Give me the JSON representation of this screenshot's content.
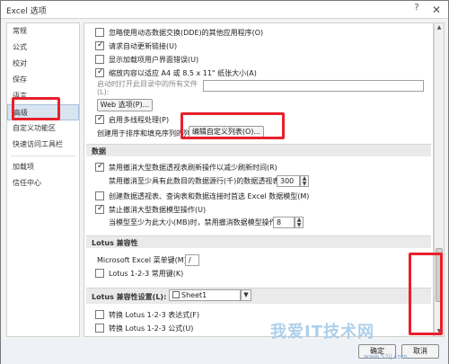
{
  "window": {
    "title": "Excel 选项",
    "help": "?",
    "close": "✕"
  },
  "sidebar": {
    "items": [
      {
        "label": "常规"
      },
      {
        "label": "公式"
      },
      {
        "label": "校对"
      },
      {
        "label": "保存"
      },
      {
        "label": "语言"
      },
      {
        "label": "高级",
        "selected": true
      },
      {
        "label": "自定义功能区"
      },
      {
        "label": "快速访问工具栏"
      },
      {
        "label": "加载项"
      },
      {
        "label": "信任中心"
      }
    ]
  },
  "content": {
    "general": {
      "row1": "忽略使用动态数据交换(DDE)的其他应用程序(O)",
      "row2": "请求自动更新链接(U)",
      "row3": "显示加载项用户界面错误(U)",
      "row4": "缩放内容以适应 A4 或 8.5 x 11\" 纸张大小(A)",
      "row5_label": "启动时打开此目录中的所有文件",
      "row5_hotkey": "(L):",
      "web_options": "Web 选项(P)...",
      "row_multithread": "启用多线程处理(P)",
      "custom_list_label": "创建用于排序和填充序列的列表:",
      "custom_list_button": "编辑自定义列表(O)..."
    },
    "data_section": {
      "title": "数据",
      "row1": "禁用撤消大型数据透视表刷新操作以减少刷新时间(R)",
      "row2_label": "禁用撤消至少具有此数目的数据源行(千)的数据透视表(N):",
      "row2_value": "300",
      "row3": "创建数据透视表、查询表和数据连接时首选 Excel 数据模型(M)",
      "row4": "禁止撤消大型数据模型操作(U)",
      "row5_label": "当模型至少为此大小(MB)时，禁用撤消数据模型操作(L):",
      "row5_value": "8"
    },
    "lotus_section": {
      "title": "Lotus 兼容性",
      "menu_key_label": "Microsoft Excel 菜单键(M):",
      "menu_key_value": "/",
      "nav_keys": "Lotus 1-2-3 常用键(K)"
    },
    "lotus_settings_section": {
      "title": "Lotus 兼容性设置(L):",
      "sheet_value": "Sheet1",
      "row1": "转换 Lotus 1-2-3 表达式(F)",
      "row2": "转换 Lotus 1-2-3 公式(U)"
    }
  },
  "footer": {
    "ok": "确定",
    "cancel": "取消"
  },
  "watermark": {
    "text": "我爱IT技术网",
    "url": "www.52ij.com"
  },
  "colors": {
    "highlight": "#e8202a",
    "selected_bg": "#d8e4f0"
  }
}
